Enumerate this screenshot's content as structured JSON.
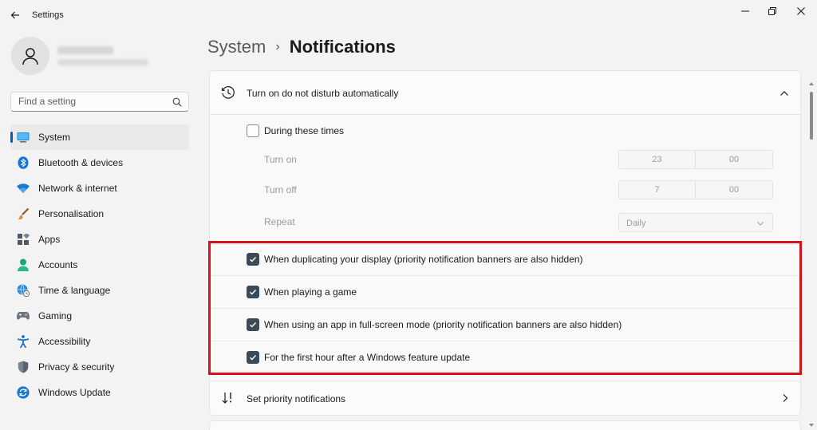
{
  "window": {
    "title": "Settings"
  },
  "sidebar": {
    "search_placeholder": "Find a setting",
    "items": [
      {
        "label": "System",
        "icon": "system-icon"
      },
      {
        "label": "Bluetooth & devices",
        "icon": "bluetooth-icon"
      },
      {
        "label": "Network & internet",
        "icon": "wifi-icon"
      },
      {
        "label": "Personalisation",
        "icon": "brush-icon"
      },
      {
        "label": "Apps",
        "icon": "apps-icon"
      },
      {
        "label": "Accounts",
        "icon": "person-icon"
      },
      {
        "label": "Time & language",
        "icon": "globe-clock-icon"
      },
      {
        "label": "Gaming",
        "icon": "gamepad-icon"
      },
      {
        "label": "Accessibility",
        "icon": "accessibility-icon"
      },
      {
        "label": "Privacy & security",
        "icon": "shield-icon"
      },
      {
        "label": "Windows Update",
        "icon": "update-icon"
      }
    ],
    "active_index": 0
  },
  "header": {
    "parent": "System",
    "separator": "›",
    "current": "Notifications"
  },
  "dnd": {
    "title": "Turn on do not disturb automatically",
    "during_label": "During these times",
    "during_checked": false,
    "turn_on_label": "Turn on",
    "turn_on_hour": "23",
    "turn_on_minute": "00",
    "turn_off_label": "Turn off",
    "turn_off_hour": "7",
    "turn_off_minute": "00",
    "repeat_label": "Repeat",
    "repeat_value": "Daily",
    "options": [
      {
        "label": "When duplicating your display (priority notification banners are also hidden)",
        "checked": true
      },
      {
        "label": "When playing a game",
        "checked": true
      },
      {
        "label": "When using an app in full-screen mode (priority notification banners are also hidden)",
        "checked": true
      },
      {
        "label": "For the first hour after a Windows feature update",
        "checked": true
      }
    ]
  },
  "priority": {
    "label": "Set priority notifications"
  },
  "colors": {
    "accent": "#005fb8",
    "highlight": "#d6131b",
    "checkbox_checked": "#3c4a58"
  }
}
